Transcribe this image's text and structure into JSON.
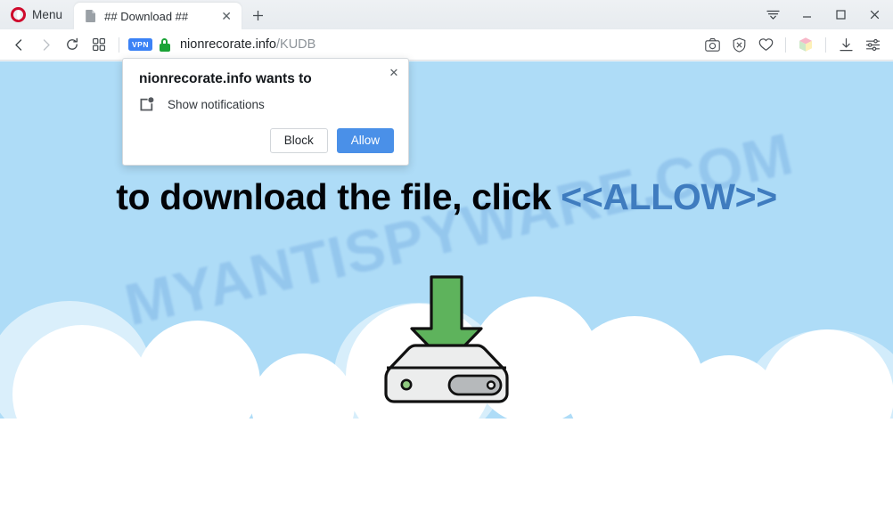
{
  "window": {
    "menu_label": "Menu",
    "tab_title": "## Download ##",
    "tab_close_glyph": "✕",
    "newtab_glyph": "＋",
    "control_minimize": "minimize",
    "control_maximize": "maximize",
    "control_close": "close"
  },
  "toolbar": {
    "back": "back",
    "forward": "forward",
    "reload": "reload",
    "speeddial": "speed-dial",
    "vpn_badge": "VPN",
    "url_domain": "nionrecorate.info",
    "url_path": "/KUDB",
    "snapshot": "snapshot",
    "adblock": "ad-blocker",
    "favorite": "favorite",
    "extension": "extension-cube",
    "downloads": "downloads",
    "easysetup": "easy-setup"
  },
  "dialog": {
    "title": "nionrecorate.info wants to",
    "permission": "Show notifications",
    "block_label": "Block",
    "allow_label": "Allow",
    "close_glyph": "✕",
    "allow_color": "#4a90e8"
  },
  "page": {
    "headline_prefix": "to download the file, click ",
    "headline_allow": "<<ALLOW>>",
    "watermark": "MYANTISPYWARE.COM",
    "sky_color": "#aedcf7",
    "cloud_color": "#ffffff",
    "allow_text_color": "#3f7cbf",
    "arrow_color": "#5eb35c",
    "drive_color": "#eceded"
  }
}
